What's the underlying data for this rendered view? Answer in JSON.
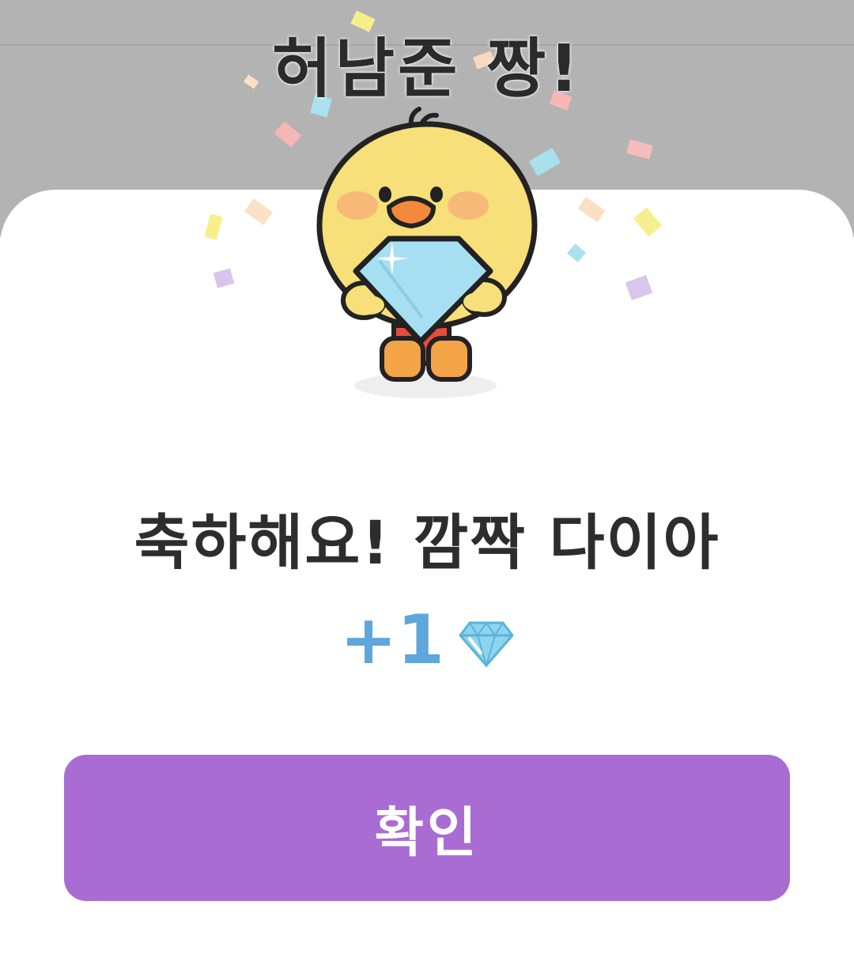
{
  "banner": {
    "text": "허남준 짱!"
  },
  "dialog": {
    "headline": "축하해요! 깜짝 다이아",
    "reward_amount": "+1",
    "reward_icon": "diamond-icon",
    "mascot": "duck-holding-diamond"
  },
  "actions": {
    "confirm_label": "확인"
  },
  "colors": {
    "backdrop": "#b3b3b3",
    "sheet": "#ffffff",
    "accent": "#a86cd3",
    "reward_text": "#5fa6dd",
    "headline_text": "#2d2d2d"
  }
}
